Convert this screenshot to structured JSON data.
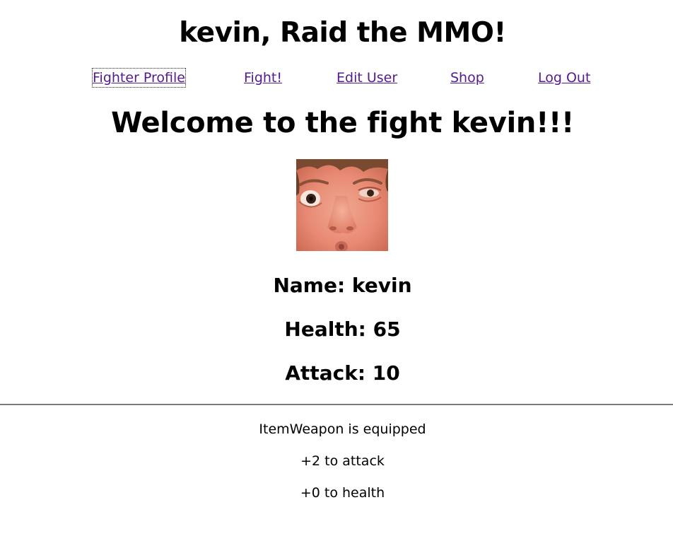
{
  "header": {
    "title": "kevin, Raid the MMO!"
  },
  "nav": {
    "items": [
      {
        "label": "Fighter Profile"
      },
      {
        "label": "Fight!"
      },
      {
        "label": "Edit User"
      },
      {
        "label": "Shop"
      },
      {
        "label": "Log Out"
      }
    ]
  },
  "main": {
    "welcome": "Welcome to the fight kevin!!!",
    "stats": {
      "name": "Name: kevin",
      "health": "Health: 65",
      "attack": "Attack: 10"
    },
    "equipment": {
      "equipped": "ItemWeapon is equipped",
      "attack_bonus": "+2 to attack",
      "health_bonus": "+0 to health"
    }
  },
  "colors": {
    "link": "#551a8b",
    "divider": "#7a7a7a",
    "text": "#000000"
  }
}
